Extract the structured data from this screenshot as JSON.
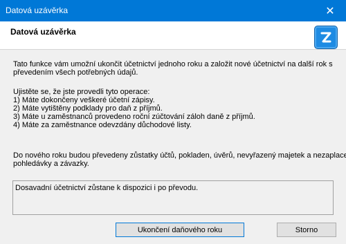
{
  "window": {
    "title": "Datová uzávěrka",
    "close_label": "✕"
  },
  "header": {
    "heading": "Datová uzávěrka",
    "logo_icon": "app-logo-icon"
  },
  "body": {
    "intro_lines": [
      "Tato funkce vám umožní ukončit účetnictví jednoho roku a založit nové účetnictví na další rok s",
      "převedením všech potřebných údajů."
    ],
    "check_lines": [
      "Ujistěte se, že jste provedli tyto operace:",
      "1) Máte dokončeny veškeré účetní zápisy.",
      "2) Máte vytištěny podklady pro daň z příjmů.",
      "3) Máte u zaměstnanců provedeno roční zúčtování záloh daně z příjmů.",
      "4) Máte za zaměstnance odevzdány důchodové listy."
    ],
    "transfer_lines": [
      "Do nového roku budou převedeny zůstatky účtů, pokladen, úvěrů, nevyřazený majetek a nezaplacené",
      "pohledávky a závazky."
    ],
    "info_text": "Dosavadní účetnictví zůstane k dispozici i po převodu."
  },
  "buttons": {
    "primary": "Ukončení daňového roku",
    "cancel": "Storno"
  },
  "colors": {
    "titlebar": "#0078d7",
    "logo": "#1e8be3"
  }
}
